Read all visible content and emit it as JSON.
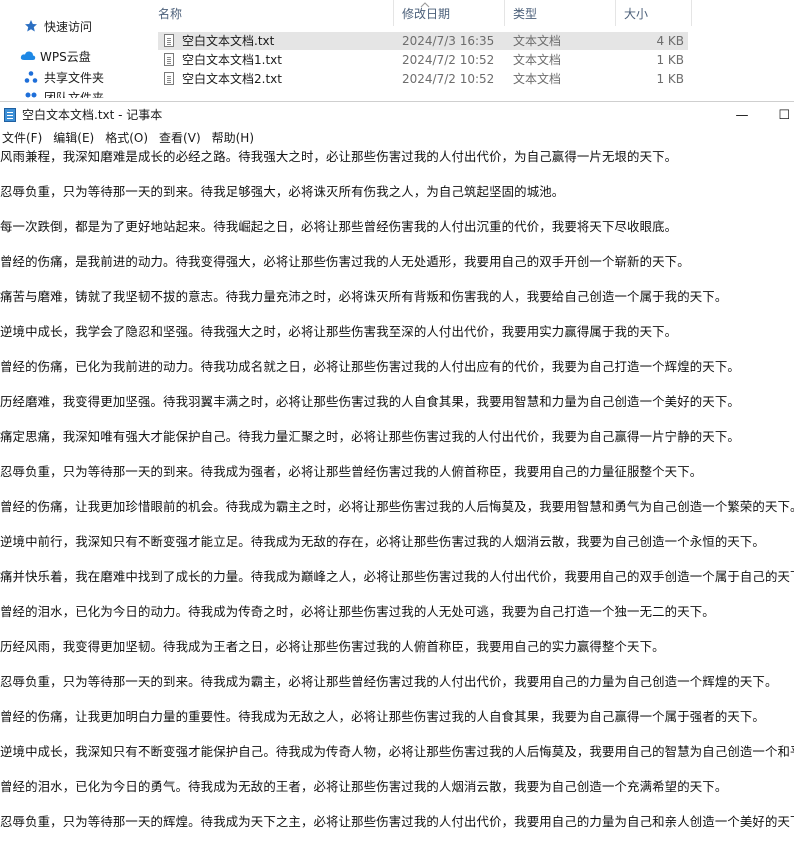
{
  "explorer": {
    "nav": [
      {
        "label": "快速访问",
        "icon": "star-icon"
      },
      {
        "label": "WPS云盘",
        "icon": "cloud-icon"
      },
      {
        "label": "共享文件夹",
        "icon": "share-icon"
      },
      {
        "label": "团队文件夹",
        "icon": "team-icon"
      }
    ],
    "columns": {
      "name": "名称",
      "date": "修改日期",
      "type": "类型",
      "size": "大小"
    },
    "files": [
      {
        "name": "空白文本文档.txt",
        "date": "2024/7/3 16:35",
        "type": "文本文档",
        "size": "4 KB",
        "selected": true
      },
      {
        "name": "空白文本文档1.txt",
        "date": "2024/7/2 10:52",
        "type": "文本文档",
        "size": "1 KB",
        "selected": false
      },
      {
        "name": "空白文本文档2.txt",
        "date": "2024/7/2 10:52",
        "type": "文本文档",
        "size": "1 KB",
        "selected": false
      }
    ]
  },
  "notepad": {
    "title": "空白文本文档.txt - 记事本",
    "minimize": "—",
    "maximize": "☐",
    "menu": [
      "文件(F)",
      "编辑(E)",
      "格式(O)",
      "查看(V)",
      "帮助(H)"
    ],
    "lines": [
      "风雨兼程，我深知磨难是成长的必经之路。待我强大之时，必让那些伤害过我的人付出代价，为自己赢得一片无垠的天下。",
      "忍辱负重，只为等待那一天的到来。待我足够强大，必将诛灭所有伤我之人，为自己筑起坚固的城池。",
      "每一次跌倒，都是为了更好地站起来。待我崛起之日，必将让那些曾经伤害我的人付出沉重的代价，我要将天下尽收眼底。",
      "曾经的伤痛，是我前进的动力。待我变得强大，必将让那些伤害过我的人无处遁形，我要用自己的双手开创一个崭新的天下。",
      "痛苦与磨难，铸就了我坚韧不拔的意志。待我力量充沛之时，必将诛灭所有背叛和伤害我的人，我要给自己创造一个属于我的天下。",
      "逆境中成长，我学会了隐忍和坚强。待我强大之时，必将让那些伤害我至深的人付出代价，我要用实力赢得属于我的天下。",
      "曾经的伤痛，已化为我前进的动力。待我功成名就之日，必将让那些伤害过我的人付出应有的代价，我要为自己打造一个辉煌的天下。",
      "历经磨难，我变得更加坚强。待我羽翼丰满之时，必将让那些伤害过我的人自食其果，我要用智慧和力量为自己创造一个美好的天下。",
      "痛定思痛，我深知唯有强大才能保护自己。待我力量汇聚之时，必将让那些伤害过我的人付出代价，我要为自己赢得一片宁静的天下。",
      "忍辱负重，只为等待那一天的到来。待我成为强者，必将让那些曾经伤害过我的人俯首称臣，我要用自己的力量征服整个天下。",
      "曾经的伤痛，让我更加珍惜眼前的机会。待我成为霸主之时，必将让那些伤害过我的人后悔莫及，我要用智慧和勇气为自己创造一个繁荣的天下。",
      "逆境中前行，我深知只有不断变强才能立足。待我成为无敌的存在，必将让那些伤害过我的人烟消云散，我要为自己创造一个永恒的天下。",
      "痛并快乐着，我在磨难中找到了成长的力量。待我成为巅峰之人，必将让那些伤害过我的人付出代价，我要用自己的双手创造一个属于自己的天下。",
      "曾经的泪水，已化为今日的动力。待我成为传奇之时，必将让那些伤害过我的人无处可逃，我要为自己打造一个独一无二的天下。",
      "历经风雨，我变得更加坚韧。待我成为王者之日，必将让那些伤害过我的人俯首称臣，我要用自己的实力赢得整个天下。",
      "忍辱负重，只为等待那一天的到来。待我成为霸主，必将让那些曾经伤害过我的人付出代价，我要用自己的力量为自己创造一个辉煌的天下。",
      "曾经的伤痛，让我更加明白力量的重要性。待我成为无敌之人，必将让那些伤害过我的人自食其果，我要为自己赢得一个属于强者的天下。",
      "逆境中成长，我深知只有不断变强才能保护自己。待我成为传奇人物，必将让那些伤害过我的人后悔莫及，我要用自己的智慧为自己创造一个和平的天下。",
      "曾经的泪水，已化为今日的勇气。待我成为无敌的王者，必将让那些伤害过我的人烟消云散，我要为自己创造一个充满希望的天下。",
      "忍辱负重，只为等待那一天的辉煌。待我成为天下之主，必将让那些伤害过我的人付出代价，我要用自己的力量为自己和亲人创造一个美好的天下。"
    ]
  },
  "colors": {
    "selected_row": "#e5e5e5",
    "header_text": "#4c607a",
    "muted_text": "#6d6d6d",
    "star": "#2b6fc2",
    "cloud": "#1e88e5"
  }
}
